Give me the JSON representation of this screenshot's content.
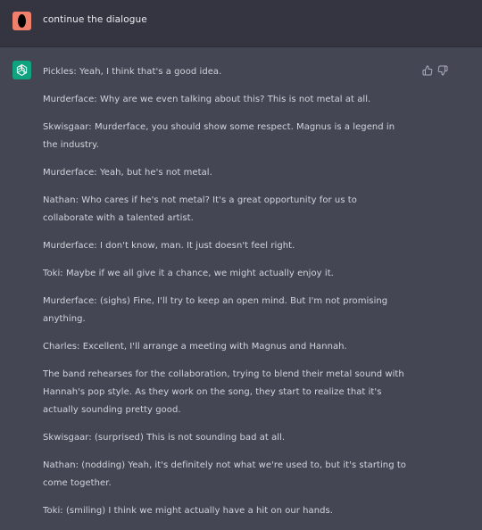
{
  "user_message": {
    "text": "continue the dialogue"
  },
  "assistant_message": {
    "paragraphs": [
      "Pickles: Yeah, I think that's a good idea.",
      "Murderface: Why are we even talking about this? This is not metal at all.",
      "Skwisgaar: Murderface, you should show some respect. Magnus is a legend in the industry.",
      "Murderface: Yeah, but he's not metal.",
      "Nathan: Who cares if he's not metal? It's a great opportunity for us to collaborate with a talented artist.",
      "Murderface: I don't know, man. It just doesn't feel right.",
      "Toki: Maybe if we all give it a chance, we might actually enjoy it.",
      "Murderface: (sighs) Fine, I'll try to keep an open mind. But I'm not promising anything.",
      "Charles: Excellent, I'll arrange a meeting with Magnus and Hannah.",
      "The band rehearses for the collaboration, trying to blend their metal sound with Hannah's pop style. As they work on the song, they start to realize that it's actually sounding pretty good.",
      "Skwisgaar: (surprised) This is not sounding bad at all.",
      "Nathan: (nodding) Yeah, it's definitely not what we're used to, but it's starting to come together.",
      "Toki: (smiling) I think we might actually have a hit on our hands."
    ]
  },
  "icons": {
    "user_avatar": "user-avatar-icon",
    "assistant_avatar": "openai-logo-icon",
    "like": "thumbs-up-icon",
    "dislike": "thumbs-down-icon"
  },
  "colors": {
    "user_row_bg": "#343541",
    "assistant_row_bg": "#444654",
    "assistant_avatar_bg": "#10a37f",
    "user_avatar_bg": "#f07f6c",
    "text": "#d1d5db"
  }
}
